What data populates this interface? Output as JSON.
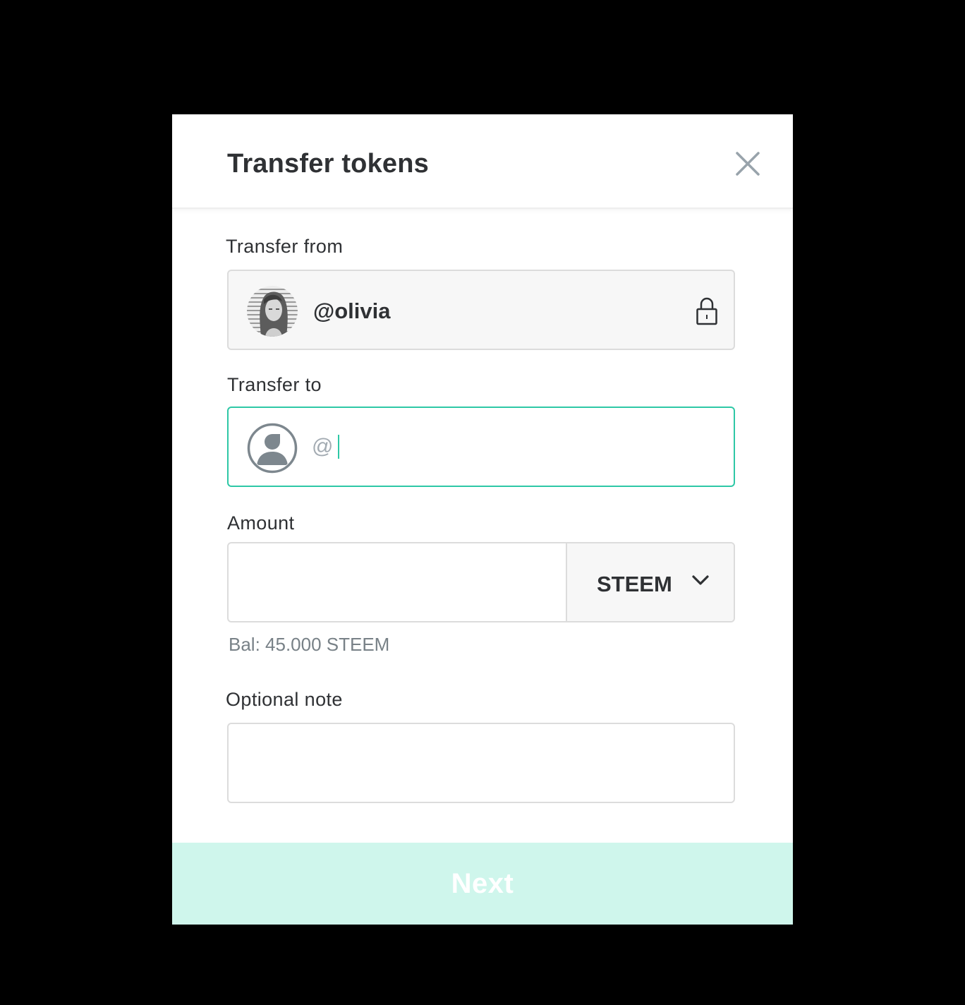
{
  "dialog": {
    "title": "Transfer tokens",
    "close_icon": "close-icon"
  },
  "transfer_from": {
    "label": "Transfer from",
    "username": "@olivia",
    "avatar_icon": "user-photo-avatar",
    "lock_icon": "lock-icon"
  },
  "transfer_to": {
    "label": "Transfer to",
    "placeholder": "@",
    "value": "",
    "avatar_icon": "user-placeholder-icon"
  },
  "amount": {
    "label": "Amount",
    "value": "",
    "currency": "STEEM",
    "chevron_icon": "chevron-down-icon",
    "balance": "Bal: 45.000 STEEM"
  },
  "note": {
    "label": "Optional note",
    "value": ""
  },
  "next_button": {
    "label": "Next"
  },
  "colors": {
    "accent": "#2ec8a6",
    "next_button_bg": "#cff6ec",
    "text": "#2f3134",
    "muted_text": "#788187",
    "field_bg": "#f7f7f7",
    "field_border": "#dcdcdc"
  }
}
